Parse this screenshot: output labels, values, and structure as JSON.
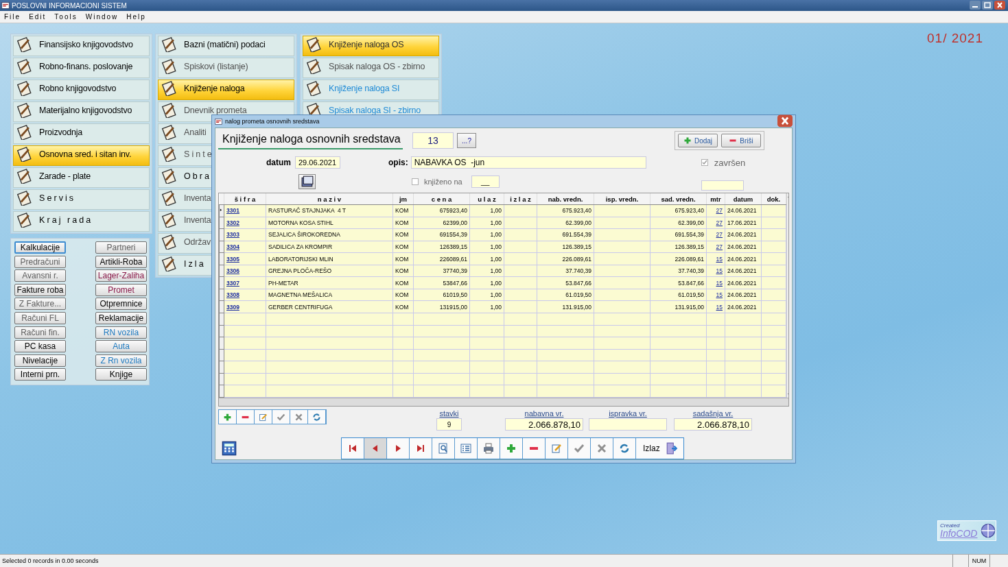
{
  "window": {
    "title": "POSLOVNI INFORMACIONI SISTEM"
  },
  "menu": [
    "File",
    "Edit",
    "Tools",
    "Window",
    "Help"
  ],
  "period": "01/ 2021",
  "main_menu": {
    "columns": [
      [
        {
          "label": "Finansijsko knjigovodstvo",
          "selected": false,
          "color": "#000000"
        },
        {
          "label": "Robno-finans. poslovanje",
          "selected": false,
          "color": "#000000"
        },
        {
          "label": "Robno knjigovodstvo",
          "selected": false,
          "color": "#000000"
        },
        {
          "label": "Materijalno knjigovodstvo",
          "selected": false,
          "color": "#000000"
        },
        {
          "label": "Proizvodnja",
          "selected": false,
          "color": "#000000"
        },
        {
          "label": "Osnovna sred. i sitan inv.",
          "selected": true,
          "color": "#000000"
        },
        {
          "label": "Zarade - plate",
          "selected": false,
          "color": "#000000"
        },
        {
          "label": "S e r v i s",
          "selected": false,
          "color": "#000000"
        },
        {
          "label": "K r a j   r a d a",
          "selected": false,
          "color": "#000000"
        }
      ],
      [
        {
          "label": "Bazni (matični) podaci",
          "selected": false,
          "color": "#000000"
        },
        {
          "label": "Spiskovi (listanje)",
          "selected": false,
          "color": "#505050"
        },
        {
          "label": "Knjiženje naloga",
          "selected": true,
          "color": "#000000"
        },
        {
          "label": "Dnevnik prometa",
          "selected": false,
          "color": "#505050"
        },
        {
          "label": "Analiti",
          "selected": false,
          "color": "#505050"
        },
        {
          "label": "S i n t e",
          "selected": false,
          "color": "#505050"
        },
        {
          "label": "O b r a",
          "selected": false,
          "color": "#000000"
        },
        {
          "label": "Inventa",
          "selected": false,
          "color": "#505050"
        },
        {
          "label": "Inventa",
          "selected": false,
          "color": "#505050"
        },
        {
          "label": "Održav",
          "selected": false,
          "color": "#505050"
        },
        {
          "label": "I z l a",
          "selected": false,
          "color": "#000000"
        }
      ],
      [
        {
          "label": "Knjiženje naloga OS",
          "selected": true,
          "color": "#303030"
        },
        {
          "label": "Spisak naloga OS - zbirno",
          "selected": false,
          "color": "#505050"
        },
        {
          "label": "Knjiženje naloga SI",
          "selected": false,
          "color": "#1e8ad6"
        },
        {
          "label": "Spisak naloga SI - zbirno",
          "selected": false,
          "color": "#1e8ad6"
        }
      ]
    ]
  },
  "quick_buttons": {
    "left": [
      {
        "label": "Kalkulacije",
        "focused": true,
        "color": "#000000"
      },
      {
        "label": "Predračuni",
        "focused": false,
        "color": "#606060"
      },
      {
        "label": "Avansni r.",
        "focused": false,
        "color": "#606060"
      },
      {
        "label": "Fakture roba",
        "focused": false,
        "color": "#000000"
      },
      {
        "label": "Z Fakture...",
        "focused": false,
        "color": "#606060"
      },
      {
        "label": "Računi FL",
        "focused": false,
        "color": "#606060"
      },
      {
        "label": "Računi fin.",
        "focused": false,
        "color": "#606060"
      },
      {
        "label": "PC kasa",
        "focused": false,
        "color": "#000000"
      },
      {
        "label": "Nivelacije",
        "focused": false,
        "color": "#000000"
      },
      {
        "label": "Interni prn.",
        "focused": false,
        "color": "#000000"
      }
    ],
    "right": [
      {
        "label": "Partneri",
        "focused": false,
        "color": "#606060"
      },
      {
        "label": "Artikli-Roba",
        "focused": false,
        "color": "#000000"
      },
      {
        "label": "Lager-Zaliha",
        "focused": false,
        "color": "#8a1a4a"
      },
      {
        "label": "Promet",
        "focused": false,
        "color": "#8a1a4a"
      },
      {
        "label": "Otpremnice",
        "focused": false,
        "color": "#000000"
      },
      {
        "label": "Reklamacije",
        "focused": false,
        "color": "#000000"
      },
      {
        "label": "RN vozila",
        "focused": false,
        "color": "#1e7ac0"
      },
      {
        "label": "Auta",
        "focused": false,
        "color": "#1e7ac0"
      },
      {
        "label": "Z Rn vozila",
        "focused": false,
        "color": "#1e7ac0"
      },
      {
        "label": "Knjige",
        "focused": false,
        "color": "#000000"
      }
    ]
  },
  "dialog": {
    "title": "nalog prometa osnovnih sredstava",
    "heading": "Knjiženje naloga osnovnih sredstava",
    "number": "13",
    "lookup_button": "...?",
    "add_button": "Dodaj",
    "delete_button": "Briši",
    "date_label": "datum",
    "date": "29.06.2021",
    "description_label": "opis:",
    "description": "NABAVKA OS  -jun",
    "finished": {
      "label": "završen",
      "checked": true
    },
    "posted": {
      "label": "knjiženo na",
      "checked": false,
      "value": "__"
    },
    "table": {
      "columns": [
        "š i f r a",
        "n a z i v",
        "jm",
        "c e n a",
        "u l a z",
        "i z l a z",
        "nab. vredn.",
        "isp. vredn.",
        "sad. vredn.",
        "mtr",
        "datum",
        "dok."
      ],
      "rows": [
        {
          "code": "3301",
          "name": "RASTURAČ STAJNJAKA  4 T",
          "unit": "KOM",
          "price": "675923,40",
          "in": "1,00",
          "purchase_value": "675.923,40",
          "present_value": "675.923,40",
          "mtr": "27",
          "date": "24.06.2021",
          "selected": true
        },
        {
          "code": "3302",
          "name": "MOTORNA KOSA STIHL",
          "unit": "KOM",
          "price": "62399,00",
          "in": "1,00",
          "purchase_value": "62.399,00",
          "present_value": "62.399,00",
          "mtr": "27",
          "date": "17.06.2021",
          "selected": false
        },
        {
          "code": "3303",
          "name": "SEJALICA ŠIROKOREDNA",
          "unit": "KOM",
          "price": "691554,39",
          "in": "1,00",
          "purchase_value": "691.554,39",
          "present_value": "691.554,39",
          "mtr": "27",
          "date": "24.06.2021",
          "selected": false
        },
        {
          "code": "3304",
          "name": "SADILICA ZA KROMPIR",
          "unit": "KOM",
          "price": "126389,15",
          "in": "1,00",
          "purchase_value": "126.389,15",
          "present_value": "126.389,15",
          "mtr": "27",
          "date": "24.06.2021",
          "selected": false
        },
        {
          "code": "3305",
          "name": "LABORATORIJSKI MLIN",
          "unit": "KOM",
          "price": "226089,61",
          "in": "1,00",
          "purchase_value": "226.089,61",
          "present_value": "226.089,61",
          "mtr": "15",
          "date": "24.06.2021",
          "selected": false
        },
        {
          "code": "3306",
          "name": "GREJNA PLOČA-REŠO",
          "unit": "KOM",
          "price": "37740,39",
          "in": "1,00",
          "purchase_value": "37.740,39",
          "present_value": "37.740,39",
          "mtr": "15",
          "date": "24.06.2021",
          "selected": false
        },
        {
          "code": "3307",
          "name": "PH-METAR",
          "unit": "KOM",
          "price": "53847,66",
          "in": "1,00",
          "purchase_value": "53.847,66",
          "present_value": "53.847,66",
          "mtr": "15",
          "date": "24.06.2021",
          "selected": false
        },
        {
          "code": "3308",
          "name": "MAGNETNA MEŠALICA",
          "unit": "KOM",
          "price": "61019,50",
          "in": "1,00",
          "purchase_value": "61.019,50",
          "present_value": "61.019,50",
          "mtr": "15",
          "date": "24.06.2021",
          "selected": false
        },
        {
          "code": "3309",
          "name": "GERBER CENTRIFUGA",
          "unit": "KOM",
          "price": "131915,00",
          "in": "1,00",
          "purchase_value": "131.915,00",
          "present_value": "131.915,00",
          "mtr": "15",
          "date": "24.06.2021",
          "selected": false
        }
      ]
    },
    "totals": [
      {
        "label": "stavki",
        "value": "9"
      },
      {
        "label": "nabavna vr.",
        "value": "2.066.878,10"
      },
      {
        "label": "ispravka vr."
      },
      {
        "label": "sadašnja vr.",
        "value": "2.066.878,10"
      }
    ],
    "exit_button": "Izlaz"
  },
  "logo": {
    "line1": "Created",
    "line2": "InfoCOD"
  },
  "status_bar": {
    "message": "Selected 0 records in 0.00 seconds",
    "indicator": "NUM"
  }
}
